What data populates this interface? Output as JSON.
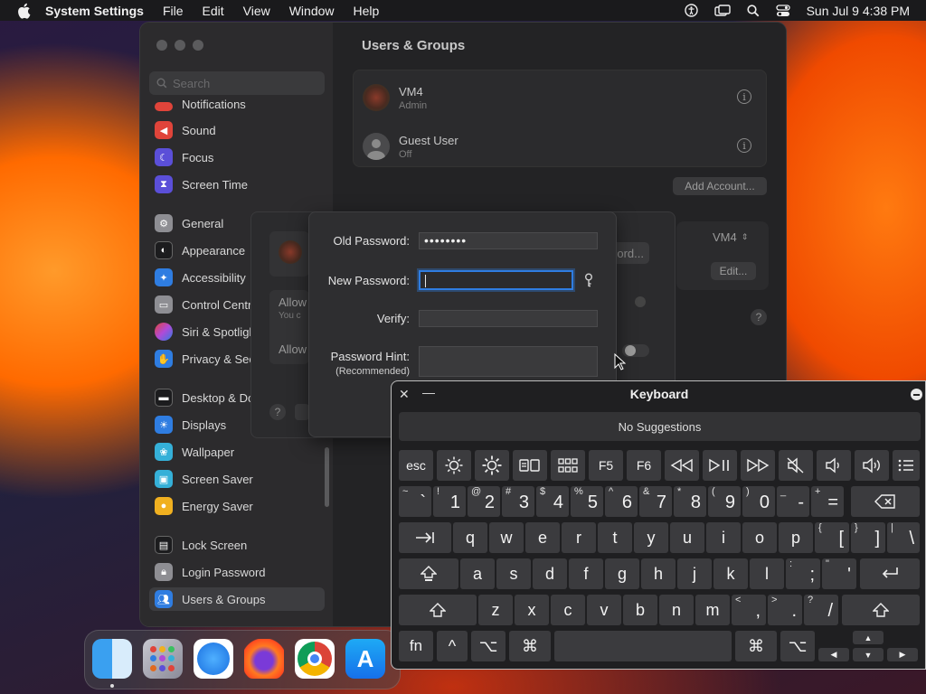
{
  "menubar": {
    "app": "System Settings",
    "items": [
      "File",
      "Edit",
      "View",
      "Window",
      "Help"
    ],
    "clock": "Sun Jul 9  4:38 PM"
  },
  "sidebar": {
    "search_placeholder": "Search",
    "items": [
      {
        "label": "Notifications",
        "color": "#e0443a"
      },
      {
        "label": "Sound",
        "color": "#e0443a"
      },
      {
        "label": "Focus",
        "color": "#5b4fd8"
      },
      {
        "label": "Screen Time",
        "color": "#5b4fd8"
      },
      {
        "label": "General",
        "color": "#8e8e93"
      },
      {
        "label": "Appearance",
        "color": "#1c1c1e"
      },
      {
        "label": "Accessibility",
        "color": "#2f7de1"
      },
      {
        "label": "Control Centre",
        "color": "#8e8e93"
      },
      {
        "label": "Siri & Spotlight",
        "color": "#b04ad8"
      },
      {
        "label": "Privacy & Security",
        "color": "#2f7de1"
      },
      {
        "label": "Desktop & Dock",
        "color": "#1c1c1e"
      },
      {
        "label": "Displays",
        "color": "#2f7de1"
      },
      {
        "label": "Wallpaper",
        "color": "#35b0d8"
      },
      {
        "label": "Screen Saver",
        "color": "#35b0d8"
      },
      {
        "label": "Energy Saver",
        "color": "#f0b020"
      },
      {
        "label": "Lock Screen",
        "color": "#1c1c1e"
      },
      {
        "label": "Login Password",
        "color": "#8e8e93"
      },
      {
        "label": "Users & Groups",
        "color": "#2f7de1"
      }
    ]
  },
  "main": {
    "title": "Users & Groups",
    "users": [
      {
        "name": "VM4",
        "status": "Admin"
      },
      {
        "name": "Guest User",
        "status": "Off"
      }
    ],
    "add_account": "Add Account...",
    "autologin_value": "VM4",
    "edit_button": "Edit...",
    "hidden_button_fragment": "ord...",
    "allow_fragment_1": "Allow",
    "allow_sub_fragment": "You c",
    "allow_fragment_2": "Allow"
  },
  "dialog": {
    "old_password_label": "Old Password:",
    "old_password_value": "••••••••",
    "new_password_label": "New Password:",
    "new_password_value": "",
    "verify_label": "Verify:",
    "hint_label": "Password Hint:",
    "hint_sub": "(Recommended)"
  },
  "keyboard": {
    "title": "Keyboard",
    "suggestions": "No Suggestions",
    "fn_row": [
      "esc",
      "F5",
      "F6"
    ],
    "number_row": [
      {
        "shift": "~",
        "main": "`"
      },
      {
        "shift": "!",
        "main": "1"
      },
      {
        "shift": "@",
        "main": "2"
      },
      {
        "shift": "#",
        "main": "3"
      },
      {
        "shift": "$",
        "main": "4"
      },
      {
        "shift": "%",
        "main": "5"
      },
      {
        "shift": "^",
        "main": "6"
      },
      {
        "shift": "&",
        "main": "7"
      },
      {
        "shift": "*",
        "main": "8"
      },
      {
        "shift": "(",
        "main": "9"
      },
      {
        "shift": ")",
        "main": "0"
      },
      {
        "shift": "_",
        "main": "-"
      },
      {
        "shift": "+",
        "main": "="
      }
    ],
    "row_q": [
      "q",
      "w",
      "e",
      "r",
      "t",
      "y",
      "u",
      "i",
      "o",
      "p"
    ],
    "row_q_tail": [
      {
        "shift": "{",
        "main": "["
      },
      {
        "shift": "}",
        "main": "]"
      },
      {
        "shift": "|",
        "main": "\\"
      }
    ],
    "row_a": [
      "a",
      "s",
      "d",
      "f",
      "g",
      "h",
      "j",
      "k",
      "l"
    ],
    "row_a_tail": [
      {
        "shift": ":",
        "main": ";"
      },
      {
        "shift": "\"",
        "main": "'"
      }
    ],
    "row_z": [
      "z",
      "x",
      "c",
      "v",
      "b",
      "n",
      "m"
    ],
    "row_z_tail": [
      {
        "shift": "<",
        "main": ","
      },
      {
        "shift": ">",
        "main": "."
      },
      {
        "shift": "?",
        "main": "/"
      }
    ],
    "bottom": {
      "fn": "fn",
      "ctrl": "^",
      "opt": "⌥",
      "cmd": "⌘"
    }
  }
}
